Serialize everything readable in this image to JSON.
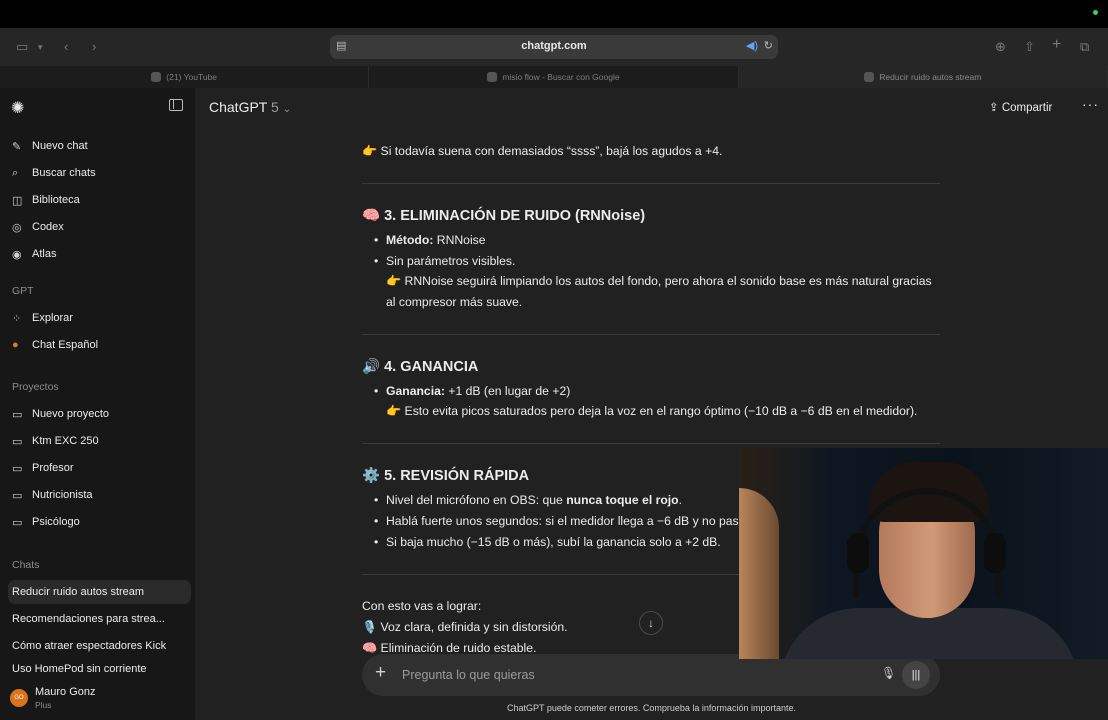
{
  "browser": {
    "url": "chatgpt.com",
    "tabs": [
      {
        "label": "(21) YouTube",
        "active": false
      },
      {
        "label": "misio flow - Buscar con Google",
        "active": false
      },
      {
        "label": "Reducir ruido autos stream",
        "active": true
      }
    ]
  },
  "sidebar": {
    "actions": [
      {
        "label": "Nuevo chat",
        "icon": "edit-icon"
      },
      {
        "label": "Buscar chats",
        "icon": "search-icon"
      },
      {
        "label": "Biblioteca",
        "icon": "library-icon"
      },
      {
        "label": "Codex",
        "icon": "codex-icon"
      },
      {
        "label": "Atlas",
        "icon": "compass-icon"
      }
    ],
    "gpt_section": "GPT",
    "gpts": [
      {
        "label": "Explorar",
        "icon": "grid-icon"
      },
      {
        "label": "Chat Español",
        "icon": "gpt-avatar-icon"
      }
    ],
    "projects_section": "Proyectos",
    "projects": [
      {
        "label": "Nuevo proyecto"
      },
      {
        "label": "Ktm EXC 250"
      },
      {
        "label": "Profesor"
      },
      {
        "label": "Nutricionista"
      },
      {
        "label": "Psicólogo"
      }
    ],
    "chats_section": "Chats",
    "chats": [
      {
        "label": "Reducir ruido autos stream",
        "active": true
      },
      {
        "label": "Recomendaciones para strea..."
      },
      {
        "label": "Cómo atraer espectadores Kick"
      },
      {
        "label": "Uso HomePod sin corriente"
      }
    ],
    "user": {
      "initials": "GO",
      "name": "Mauro Gonz",
      "plan": "Plus"
    }
  },
  "header": {
    "title": "ChatGPT",
    "version": "5",
    "share_label": "Compartir"
  },
  "message": {
    "intro_tip": "👉 Si todavía suena con demasiados “ssss”, bajá los agudos a +4.",
    "s3": {
      "heading": "🧠 3. ELIMINACIÓN DE RUIDO (RNNoise)",
      "method_label": "Método:",
      "method_value": " RNNoise",
      "params": "Sin parámetros visibles.",
      "tip_line1": "👉 RNNoise seguirá limpiando los autos del fondo, pero ahora el sonido base es más natural gracias",
      "tip_line2": "al compresor más suave."
    },
    "s4": {
      "heading": "🔊 4. GANANCIA",
      "gain_label": "Ganancia:",
      "gain_value": " +1 dB (en lugar de +2)",
      "tip": "👉 Esto evita picos saturados pero deja la voz en el rango óptimo (−10 dB a −6 dB en el medidor)."
    },
    "s5": {
      "heading": "⚙️ 5. REVISIÓN RÁPIDA",
      "b1_pre": "Nivel del micrófono en OBS: que ",
      "b1_bold": "nunca toque el rojo",
      "b1_post": ".",
      "b2": "Hablá fuerte unos segundos: si el medidor llega a −6 dB y no pas",
      "b3": "Si baja mucho (−15 dB o más), subí la ganancia solo a +2 dB."
    },
    "outro": {
      "lead": "Con esto vas a lograr:",
      "item1": "🎙️ Voz clara, definida y sin distorsión.",
      "item2": "🧠 Eliminación de ruido estable."
    }
  },
  "composer": {
    "placeholder": "Pregunta lo que quieras"
  },
  "disclaimer": "ChatGPT puede cometer errores. Comprueba la información importante.",
  "colors": {
    "main_bg": "#212121",
    "sidebar_bg": "#171717",
    "composer_bg": "#303030",
    "accent_speaker": "#5aa7ff"
  }
}
